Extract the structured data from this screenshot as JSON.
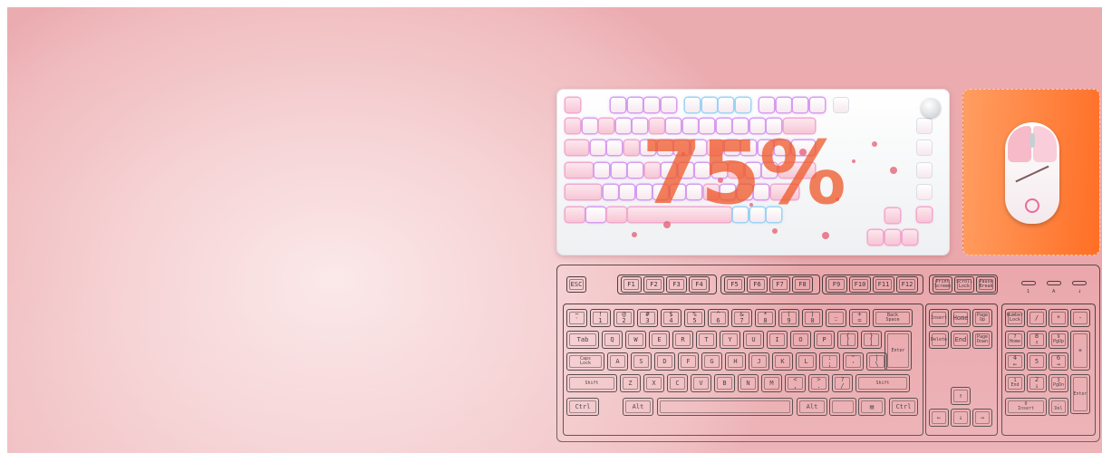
{
  "promo": {
    "percent_text": "75%"
  },
  "colors": {
    "background": "#f6d2d4",
    "accent_orange": "#ff6e24",
    "headline": "#ef5a2c"
  },
  "full_keyboard": {
    "rows": [
      [
        "ESC",
        "F1",
        "F2",
        "F3",
        "F4",
        "F5",
        "F6",
        "F7",
        "F8",
        "F9",
        "F10",
        "F11",
        "F12",
        "Print\nScreen",
        "Scroll\nLock",
        "Pause\nBreak"
      ],
      [
        "~\n`",
        "!\n1",
        "@\n2",
        "#\n3",
        "$\n4",
        "%\n5",
        "^\n6",
        "&\n7",
        "*\n8",
        "(\n9",
        ")\n0",
        "_\n-",
        "+\n=",
        "Back\nSpace",
        "Insert",
        "Home",
        "Page\nUp",
        "Number\nLock",
        "/",
        "*",
        "-"
      ],
      [
        "Tab",
        "Q",
        "W",
        "E",
        "R",
        "T",
        "Y",
        "U",
        "I",
        "O",
        "P",
        "{\n[",
        "}\n]",
        "Enter",
        "Delete",
        "End",
        "Page\nDown",
        "7\nHome",
        "8\n↑",
        "9\nPgUp",
        "+"
      ],
      [
        "Caps\nLock",
        "A",
        "S",
        "D",
        "F",
        "G",
        "H",
        "J",
        "K",
        "L",
        ":\n;",
        "\"\n'",
        "|\n\\",
        "4\n←",
        "5",
        "6\n→"
      ],
      [
        "Shift",
        "Z",
        "X",
        "C",
        "V",
        "B",
        "N",
        "M",
        "<\n,",
        ">\n.",
        "?\n/",
        "Shift",
        "↑",
        "1\nEnd",
        "2\n↓",
        "3\nPgDn",
        "Enter"
      ],
      [
        "Ctrl",
        "Alt",
        "",
        "Alt",
        "",
        "▤",
        "Ctrl",
        "←",
        "↓",
        "→",
        "0\nInsert",
        ".\nDel"
      ]
    ],
    "indicator_labels": [
      "1",
      "A",
      "↓"
    ]
  }
}
